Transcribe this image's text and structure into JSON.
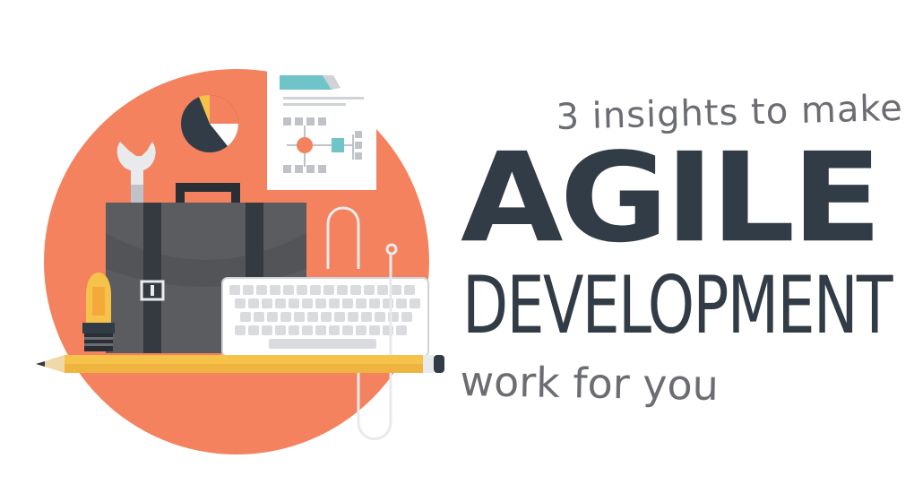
{
  "headline": {
    "tagline_top": "3 insights to make",
    "title": "AGILE",
    "subtitle": "DEVELOPMENT",
    "tagline_bottom": "work for you"
  },
  "colors": {
    "circle": "#f4825f",
    "dark": "#313c46",
    "gray_text": "#6b6d73",
    "briefcase": "#5a5c60",
    "briefcase_strap": "#343a40",
    "keyboard": "#e9eaec",
    "pencil": "#f7c24a",
    "bulb": "#f6c04c",
    "accent_teal": "#6ec4c9",
    "paper": "#ffffff"
  },
  "illustration": {
    "icons": [
      "wrench-icon",
      "pie-chart-icon",
      "document-icon",
      "flowchart-icon",
      "briefcase-icon",
      "keyboard-icon",
      "light-bulb-icon",
      "pencil-icon",
      "mouse-cable-icon"
    ]
  }
}
